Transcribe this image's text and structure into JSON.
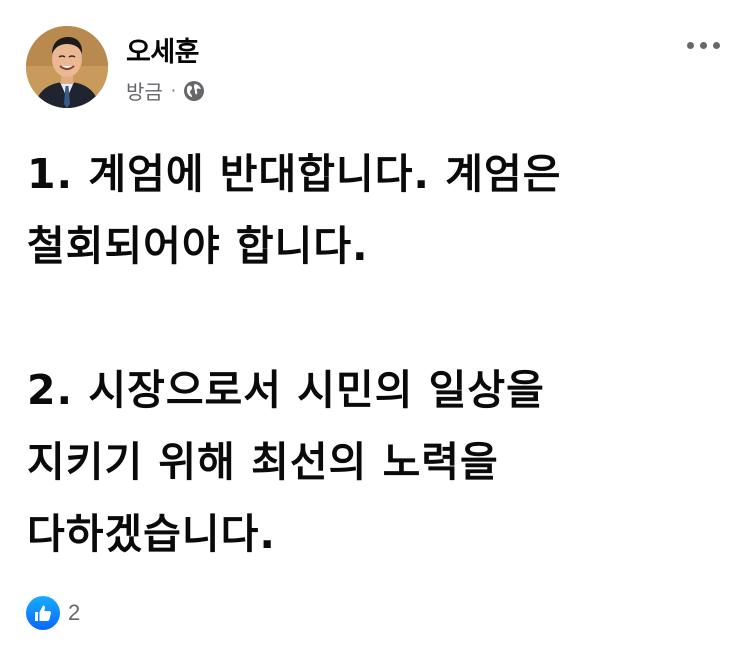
{
  "post": {
    "author": {
      "name": "오세훈",
      "avatar_icon": "profile-photo"
    },
    "meta": {
      "time": "방금",
      "separator": "·",
      "audience_icon": "globe-icon"
    },
    "more_icon": "more-options-icon",
    "content": {
      "paragraph1": {
        "line1": "1. 계엄에 반대합니다. 계엄은",
        "line2": "철회되어야 합니다."
      },
      "paragraph2": {
        "line1": "2. 시장으로서 시민의 일상을",
        "line2": "지키기 위해 최선의 노력을",
        "line3": "다하겠습니다."
      }
    },
    "reactions": {
      "icon": "like-icon",
      "count": "2",
      "accent_color": "#0866ff"
    }
  }
}
